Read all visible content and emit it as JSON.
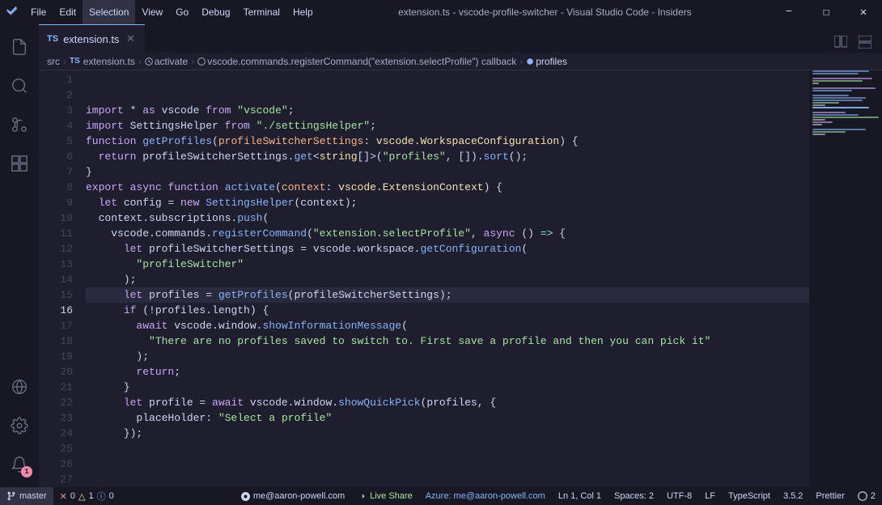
{
  "titlebar": {
    "title": "extension.ts - vscode-profile-switcher - Visual Studio Code - Insiders",
    "menu": [
      "File",
      "Edit",
      "Selection",
      "View",
      "Go",
      "Debug",
      "Terminal",
      "Help"
    ]
  },
  "tabs": [
    {
      "icon": "TS",
      "label": "extension.ts",
      "active": true
    }
  ],
  "breadcrumb": {
    "items": [
      "src",
      "TS extension.ts",
      "activate",
      "vscode.commands.registerCommand(\"extension.selectProfile\") callback",
      "profiles"
    ]
  },
  "statusbar": {
    "git_branch": "master",
    "errors": "0",
    "warnings": "1",
    "info": "0",
    "position": "Ln 1, Col 1",
    "spaces": "Spaces: 2",
    "encoding": "UTF-8",
    "line_ending": "LF",
    "language": "TypeScript",
    "version": "3.5.2",
    "formatter": "Prettier",
    "live_share": "Live Share",
    "azure": "Azure: me@aaron-powell.com",
    "user": "me@aaron-powell.com",
    "notification": "1"
  },
  "code_lines": [
    {
      "num": 1,
      "tokens": [
        {
          "t": "kw",
          "v": "import"
        },
        {
          "t": "var",
          "v": " * "
        },
        {
          "t": "kw",
          "v": "as"
        },
        {
          "t": "var",
          "v": " vscode "
        },
        {
          "t": "kw",
          "v": "from"
        },
        {
          "t": "var",
          "v": " "
        },
        {
          "t": "str",
          "v": "\"vscode\""
        },
        {
          "t": "var",
          "v": ";"
        }
      ]
    },
    {
      "num": 2,
      "tokens": [
        {
          "t": "kw",
          "v": "import"
        },
        {
          "t": "var",
          "v": " SettingsHelper "
        },
        {
          "t": "kw",
          "v": "from"
        },
        {
          "t": "var",
          "v": " "
        },
        {
          "t": "str",
          "v": "\"./settingsHelper\""
        },
        {
          "t": "var",
          "v": ";"
        }
      ]
    },
    {
      "num": 3,
      "tokens": []
    },
    {
      "num": 4,
      "tokens": [
        {
          "t": "kw",
          "v": "function"
        },
        {
          "t": "var",
          "v": " "
        },
        {
          "t": "fn",
          "v": "getProfiles"
        },
        {
          "t": "var",
          "v": "("
        },
        {
          "t": "param",
          "v": "profileSwitcherSettings"
        },
        {
          "t": "var",
          "v": ": "
        },
        {
          "t": "type",
          "v": "vscode.WorkspaceConfiguration"
        },
        {
          "t": "var",
          "v": ") {"
        }
      ]
    },
    {
      "num": 5,
      "tokens": [
        {
          "t": "var",
          "v": "  "
        },
        {
          "t": "kw",
          "v": "return"
        },
        {
          "t": "var",
          "v": " profileSwitcherSettings."
        },
        {
          "t": "fn",
          "v": "get"
        },
        {
          "t": "var",
          "v": "<"
        },
        {
          "t": "type",
          "v": "string"
        },
        {
          "t": "var",
          "v": "[]>("
        },
        {
          "t": "str",
          "v": "\"profiles\""
        },
        {
          "t": "var",
          "v": ", [])."
        },
        {
          "t": "fn",
          "v": "sort"
        },
        {
          "t": "var",
          "v": "();"
        }
      ]
    },
    {
      "num": 6,
      "tokens": [
        {
          "t": "var",
          "v": "}"
        }
      ]
    },
    {
      "num": 7,
      "tokens": []
    },
    {
      "num": 8,
      "tokens": [
        {
          "t": "kw",
          "v": "export"
        },
        {
          "t": "var",
          "v": " "
        },
        {
          "t": "kw",
          "v": "async"
        },
        {
          "t": "var",
          "v": " "
        },
        {
          "t": "kw",
          "v": "function"
        },
        {
          "t": "var",
          "v": " "
        },
        {
          "t": "fn",
          "v": "activate"
        },
        {
          "t": "var",
          "v": "("
        },
        {
          "t": "param",
          "v": "context"
        },
        {
          "t": "var",
          "v": ": "
        },
        {
          "t": "type",
          "v": "vscode.ExtensionContext"
        },
        {
          "t": "var",
          "v": ") {"
        }
      ]
    },
    {
      "num": 9,
      "tokens": [
        {
          "t": "var",
          "v": "  "
        },
        {
          "t": "kw",
          "v": "let"
        },
        {
          "t": "var",
          "v": " config = "
        },
        {
          "t": "kw",
          "v": "new"
        },
        {
          "t": "var",
          "v": " "
        },
        {
          "t": "fn",
          "v": "SettingsHelper"
        },
        {
          "t": "var",
          "v": "(context);"
        }
      ]
    },
    {
      "num": 10,
      "tokens": []
    },
    {
      "num": 11,
      "tokens": [
        {
          "t": "var",
          "v": "  context.subscriptions."
        },
        {
          "t": "fn",
          "v": "push"
        },
        {
          "t": "var",
          "v": "("
        }
      ]
    },
    {
      "num": 12,
      "tokens": [
        {
          "t": "var",
          "v": "    vscode.commands."
        },
        {
          "t": "fn",
          "v": "registerCommand"
        },
        {
          "t": "var",
          "v": "("
        },
        {
          "t": "str",
          "v": "\"extension.selectProfile\""
        },
        {
          "t": "var",
          "v": ", "
        },
        {
          "t": "kw",
          "v": "async"
        },
        {
          "t": "var",
          "v": " () "
        },
        {
          "t": "arrow",
          "v": "=>"
        },
        {
          "t": "var",
          "v": " {"
        }
      ]
    },
    {
      "num": 13,
      "tokens": [
        {
          "t": "var",
          "v": "      "
        },
        {
          "t": "kw",
          "v": "let"
        },
        {
          "t": "var",
          "v": " profileSwitcherSettings = vscode.workspace."
        },
        {
          "t": "fn",
          "v": "getConfiguration"
        },
        {
          "t": "var",
          "v": "("
        }
      ]
    },
    {
      "num": 14,
      "tokens": [
        {
          "t": "var",
          "v": "        "
        },
        {
          "t": "str",
          "v": "\"profileSwitcher\""
        }
      ]
    },
    {
      "num": 15,
      "tokens": [
        {
          "t": "var",
          "v": "      );"
        }
      ]
    },
    {
      "num": 16,
      "tokens": [
        {
          "t": "var",
          "v": "      "
        },
        {
          "t": "kw",
          "v": "let"
        },
        {
          "t": "var",
          "v": " profiles = "
        },
        {
          "t": "fn",
          "v": "getProfiles"
        },
        {
          "t": "var",
          "v": "(profileSwitcherSettings);"
        }
      ],
      "active": true
    },
    {
      "num": 17,
      "tokens": []
    },
    {
      "num": 18,
      "tokens": [
        {
          "t": "var",
          "v": "      "
        },
        {
          "t": "kw",
          "v": "if"
        },
        {
          "t": "var",
          "v": " (!profiles.length) {"
        }
      ]
    },
    {
      "num": 19,
      "tokens": [
        {
          "t": "var",
          "v": "        "
        },
        {
          "t": "kw",
          "v": "await"
        },
        {
          "t": "var",
          "v": " vscode.window."
        },
        {
          "t": "fn",
          "v": "showInformationMessage"
        },
        {
          "t": "var",
          "v": "("
        }
      ]
    },
    {
      "num": 20,
      "tokens": [
        {
          "t": "var",
          "v": "          "
        },
        {
          "t": "str",
          "v": "\"There are no profiles saved to switch to. First save a profile and then you can pick it\""
        }
      ]
    },
    {
      "num": 21,
      "tokens": [
        {
          "t": "var",
          "v": "        );"
        }
      ]
    },
    {
      "num": 22,
      "tokens": [
        {
          "t": "var",
          "v": "        "
        },
        {
          "t": "kw",
          "v": "return"
        },
        {
          "t": "var",
          "v": ";"
        }
      ]
    },
    {
      "num": 23,
      "tokens": [
        {
          "t": "var",
          "v": "      }"
        }
      ]
    },
    {
      "num": 24,
      "tokens": []
    },
    {
      "num": 25,
      "tokens": [
        {
          "t": "var",
          "v": "      "
        },
        {
          "t": "kw",
          "v": "let"
        },
        {
          "t": "var",
          "v": " profile = "
        },
        {
          "t": "kw",
          "v": "await"
        },
        {
          "t": "var",
          "v": " vscode.window."
        },
        {
          "t": "fn",
          "v": "showQuickPick"
        },
        {
          "t": "var",
          "v": "(profiles, {"
        }
      ]
    },
    {
      "num": 26,
      "tokens": [
        {
          "t": "var",
          "v": "        placeHolder: "
        },
        {
          "t": "str",
          "v": "\"Select a profile\""
        }
      ]
    },
    {
      "num": 27,
      "tokens": [
        {
          "t": "var",
          "v": "      });"
        }
      ]
    }
  ]
}
